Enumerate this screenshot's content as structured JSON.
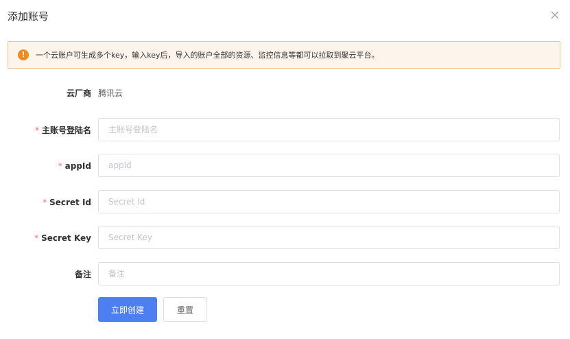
{
  "dialog": {
    "title": "添加账号",
    "close_icon": "close-icon"
  },
  "alert": {
    "icon": "warning-icon",
    "color": "#f08c1a",
    "text": "一个云账户可生成多个key，输入key后，导入的账户全部的资源、监控信息等都可以拉取到聚云平台。"
  },
  "form": {
    "provider": {
      "label": "云厂商",
      "value": "腾讯云"
    },
    "main_account": {
      "required_mark": "*",
      "label": "主账号登陆名",
      "placeholder": "主账号登陆名",
      "value": ""
    },
    "app_id": {
      "required_mark": "*",
      "label": "appId",
      "placeholder": "appId",
      "value": ""
    },
    "secret_id": {
      "required_mark": "*",
      "label": "Secret Id",
      "placeholder": "Secret Id",
      "value": ""
    },
    "secret_key": {
      "required_mark": "*",
      "label": "Secret Key",
      "placeholder": "Secret Key",
      "value": ""
    },
    "remark": {
      "label": "备注",
      "placeholder": "备注",
      "value": ""
    }
  },
  "actions": {
    "create_label": "立即创建",
    "reset_label": "重置",
    "primary_color": "#4d7ff2"
  }
}
